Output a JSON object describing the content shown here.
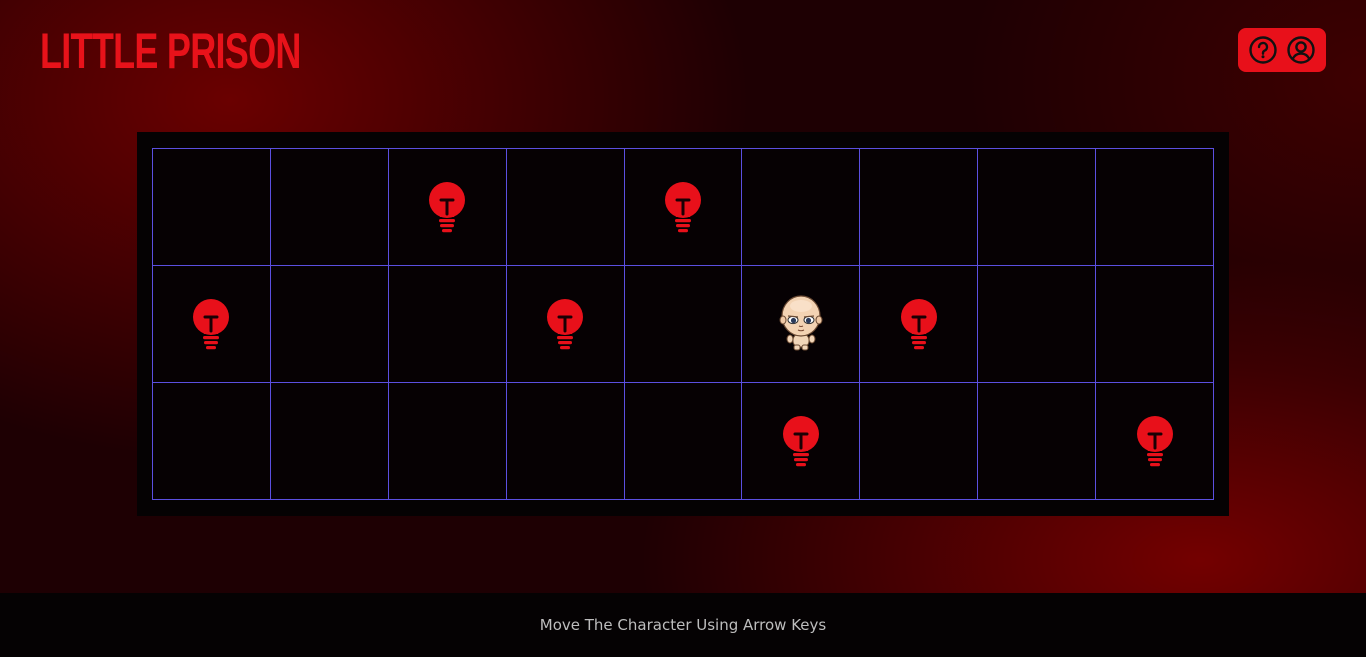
{
  "header": {
    "title": "LITTLE PRISON",
    "help_icon": "question-circle-icon",
    "profile_icon": "user-circle-icon",
    "accent_color": "#e8121a"
  },
  "board": {
    "rows": 3,
    "cols": 9,
    "grid_line_color": "#5b4fe0",
    "cells": [
      [
        "empty",
        "empty",
        "bulb",
        "empty",
        "bulb",
        "empty",
        "empty",
        "empty",
        "empty"
      ],
      [
        "bulb",
        "empty",
        "empty",
        "bulb",
        "empty",
        "character",
        "bulb",
        "empty",
        "empty"
      ],
      [
        "empty",
        "empty",
        "empty",
        "empty",
        "empty",
        "bulb",
        "empty",
        "empty",
        "bulb"
      ]
    ]
  },
  "footer": {
    "instructions": "Move The Character Using Arrow Keys"
  }
}
